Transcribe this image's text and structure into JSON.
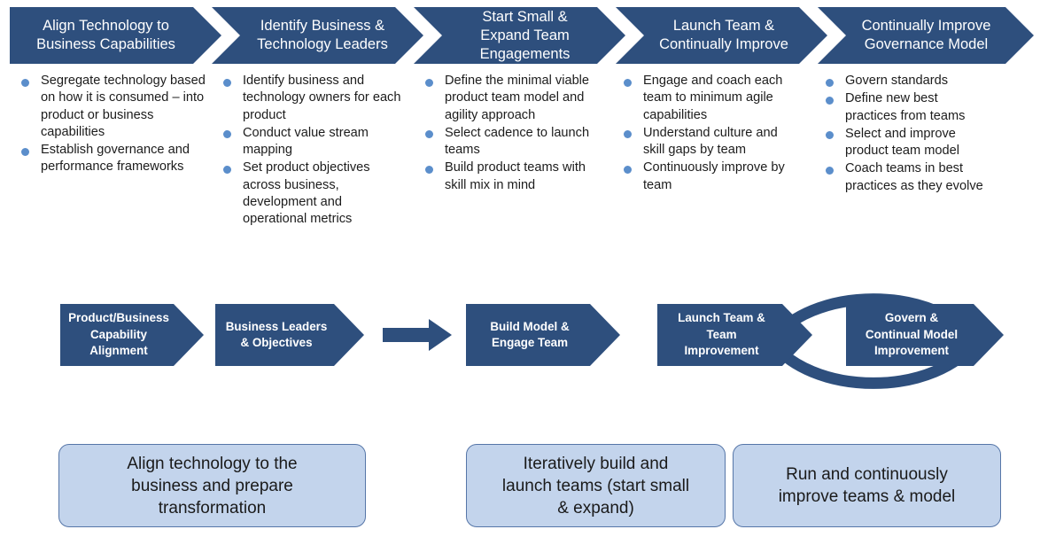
{
  "colors": {
    "navy": "#2E4F7D",
    "bullet_blue": "#5B8ECB",
    "box_fill": "#C3D4EC",
    "box_border": "#5676A8",
    "white": "#FFFFFF"
  },
  "header": {
    "steps": [
      {
        "id": "align-technology",
        "title": "Align Technology to\nBusiness Capabilities"
      },
      {
        "id": "identify-leaders",
        "title": "Identify Business &\nTechnology Leaders"
      },
      {
        "id": "start-small",
        "title": "Start Small &\nExpand Team\nEngagements"
      },
      {
        "id": "launch-team",
        "title": "Launch Team &\nContinually Improve"
      },
      {
        "id": "improve-governance",
        "title": "Continually Improve\nGovernance Model"
      }
    ]
  },
  "columns": [
    {
      "id": "align-technology",
      "bullets": [
        "Segregate technology based on how it is consumed – into product or business capabilities",
        "Establish governance and performance frameworks"
      ]
    },
    {
      "id": "identify-leaders",
      "bullets": [
        "Identify business and technology owners for each product",
        "Conduct value stream mapping",
        "Set product objectives across business, development and operational metrics"
      ]
    },
    {
      "id": "start-small",
      "bullets": [
        "Define the minimal viable product team model and agility approach",
        "Select cadence to launch teams",
        "Build product teams with skill mix in mind"
      ]
    },
    {
      "id": "launch-team",
      "bullets": [
        "Engage and coach each team to minimum agile capabilities",
        "Understand culture and skill gaps by team",
        "Continuously improve by team"
      ]
    },
    {
      "id": "improve-governance",
      "bullets": [
        "Govern standards",
        "Define new best practices from teams",
        "Select and improve product team model",
        "Coach teams in best practices as they evolve"
      ]
    }
  ],
  "flow": {
    "chevrons": [
      {
        "id": "capability-alignment",
        "label": "Product/Business\nCapability\nAlignment"
      },
      {
        "id": "business-leaders",
        "label": "Business Leaders\n& Objectives"
      },
      {
        "id": "build-model",
        "label": "Build Model &\nEngage Team"
      },
      {
        "id": "launch-team-improvement",
        "label": "Launch Team &\nTeam\nImprovement"
      },
      {
        "id": "govern-continual-improvement",
        "label": "Govern &\nContinual Model\nImprovement"
      }
    ],
    "connector_icon": "right-arrow-icon",
    "cycle_icon": "circular-arrows-icon"
  },
  "phases": [
    {
      "id": "phase-align",
      "text": "Align technology to the\nbusiness and prepare\ntransformation"
    },
    {
      "id": "phase-build",
      "text": "Iteratively build and\nlaunch teams (start small\n& expand)"
    },
    {
      "id": "phase-run",
      "text": "Run and continuously\nimprove teams & model"
    }
  ]
}
